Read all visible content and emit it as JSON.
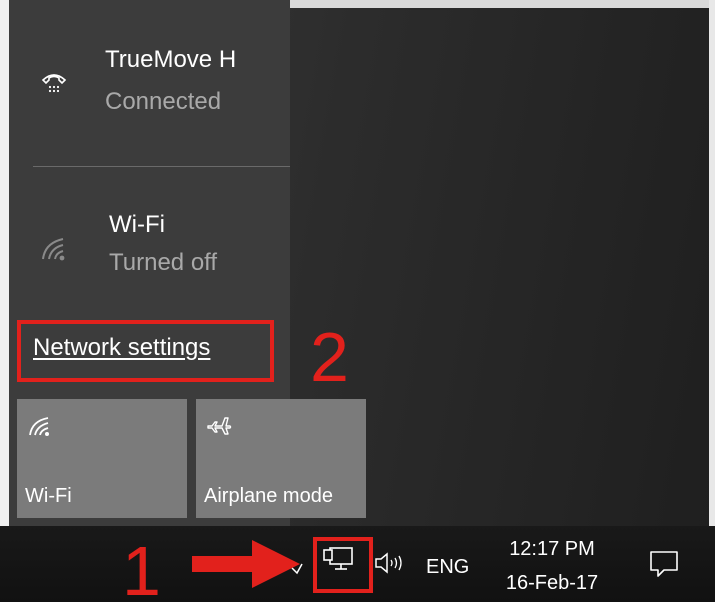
{
  "networks": [
    {
      "name": "TrueMove H",
      "status": "Connected",
      "icon": "dialup-phone-icon"
    },
    {
      "name": "Wi-Fi",
      "status": "Turned off",
      "icon": "wifi-icon"
    }
  ],
  "network_settings_link": "Network settings",
  "quick_actions": [
    {
      "label": "Wi-Fi",
      "icon": "wifi-icon"
    },
    {
      "label": "Airplane mode",
      "icon": "airplane-icon"
    }
  ],
  "annotations": {
    "step1": "1",
    "step2": "2",
    "color": "#e2211c"
  },
  "taskbar": {
    "language": "ENG",
    "time": "12:17 PM",
    "date": "16-Feb-17",
    "icons": [
      "show-hidden-icons-icon",
      "network-icon",
      "volume-icon",
      "action-center-icon"
    ]
  },
  "colors": {
    "flyout_bg": "#3c3c3c",
    "tile_bg": "#7b7b7b",
    "taskbar_bg": "#151515",
    "text_secondary": "#a9a9a9"
  }
}
